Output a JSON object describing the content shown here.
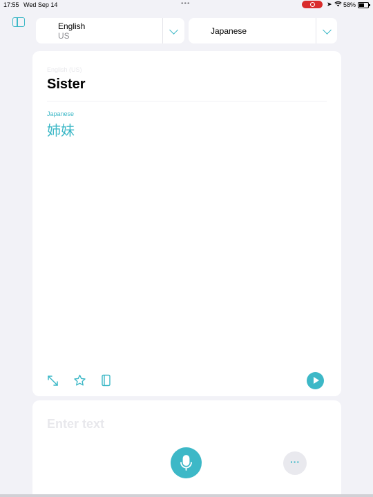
{
  "status_bar": {
    "time": "17:55",
    "date": "Wed Sep 14",
    "battery": "58%"
  },
  "language_selector": {
    "from": {
      "language": "English",
      "region": "US"
    },
    "to": {
      "language": "Japanese"
    }
  },
  "translation": {
    "source_language_label": "English (US)",
    "source_text": "Sister",
    "target_language_label": "Japanese",
    "target_text": "姉妹"
  },
  "input": {
    "placeholder": "Enter text"
  },
  "colors": {
    "accent": "#3db8c7",
    "background": "#f2f2f7",
    "recording": "#d92c2c"
  },
  "icons": [
    "sidebar-icon",
    "chevron-down-icon",
    "expand-icon",
    "star-icon",
    "book-icon",
    "play-icon",
    "microphone-icon",
    "more-icon",
    "location-icon",
    "wifi-icon",
    "battery-icon",
    "record-icon"
  ]
}
